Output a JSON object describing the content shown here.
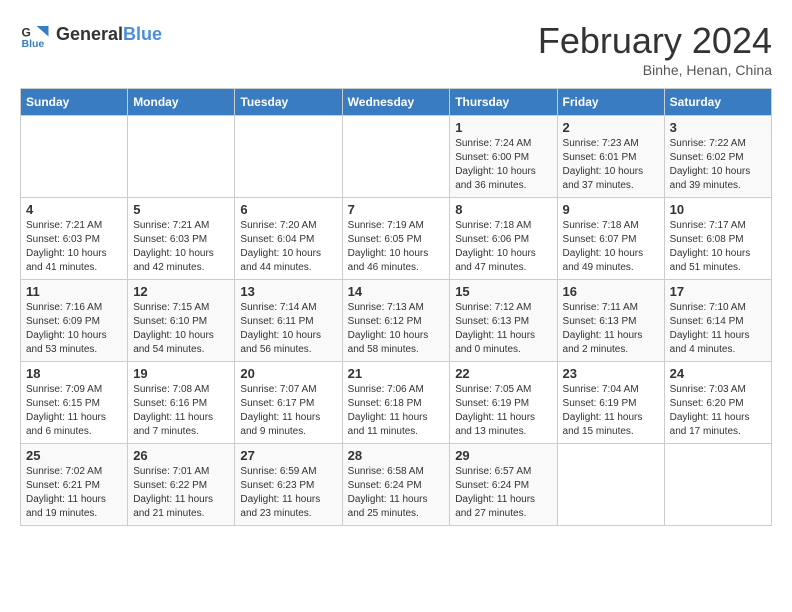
{
  "app": {
    "name": "GeneralBlue",
    "title": "February 2024",
    "subtitle": "Binhe, Henan, China"
  },
  "days_of_week": [
    "Sunday",
    "Monday",
    "Tuesday",
    "Wednesday",
    "Thursday",
    "Friday",
    "Saturday"
  ],
  "weeks": [
    [
      {
        "day": "",
        "info": ""
      },
      {
        "day": "",
        "info": ""
      },
      {
        "day": "",
        "info": ""
      },
      {
        "day": "",
        "info": ""
      },
      {
        "day": "1",
        "info": "Sunrise: 7:24 AM\nSunset: 6:00 PM\nDaylight: 10 hours\nand 36 minutes."
      },
      {
        "day": "2",
        "info": "Sunrise: 7:23 AM\nSunset: 6:01 PM\nDaylight: 10 hours\nand 37 minutes."
      },
      {
        "day": "3",
        "info": "Sunrise: 7:22 AM\nSunset: 6:02 PM\nDaylight: 10 hours\nand 39 minutes."
      }
    ],
    [
      {
        "day": "4",
        "info": "Sunrise: 7:21 AM\nSunset: 6:03 PM\nDaylight: 10 hours\nand 41 minutes."
      },
      {
        "day": "5",
        "info": "Sunrise: 7:21 AM\nSunset: 6:03 PM\nDaylight: 10 hours\nand 42 minutes."
      },
      {
        "day": "6",
        "info": "Sunrise: 7:20 AM\nSunset: 6:04 PM\nDaylight: 10 hours\nand 44 minutes."
      },
      {
        "day": "7",
        "info": "Sunrise: 7:19 AM\nSunset: 6:05 PM\nDaylight: 10 hours\nand 46 minutes."
      },
      {
        "day": "8",
        "info": "Sunrise: 7:18 AM\nSunset: 6:06 PM\nDaylight: 10 hours\nand 47 minutes."
      },
      {
        "day": "9",
        "info": "Sunrise: 7:18 AM\nSunset: 6:07 PM\nDaylight: 10 hours\nand 49 minutes."
      },
      {
        "day": "10",
        "info": "Sunrise: 7:17 AM\nSunset: 6:08 PM\nDaylight: 10 hours\nand 51 minutes."
      }
    ],
    [
      {
        "day": "11",
        "info": "Sunrise: 7:16 AM\nSunset: 6:09 PM\nDaylight: 10 hours\nand 53 minutes."
      },
      {
        "day": "12",
        "info": "Sunrise: 7:15 AM\nSunset: 6:10 PM\nDaylight: 10 hours\nand 54 minutes."
      },
      {
        "day": "13",
        "info": "Sunrise: 7:14 AM\nSunset: 6:11 PM\nDaylight: 10 hours\nand 56 minutes."
      },
      {
        "day": "14",
        "info": "Sunrise: 7:13 AM\nSunset: 6:12 PM\nDaylight: 10 hours\nand 58 minutes."
      },
      {
        "day": "15",
        "info": "Sunrise: 7:12 AM\nSunset: 6:13 PM\nDaylight: 11 hours\nand 0 minutes."
      },
      {
        "day": "16",
        "info": "Sunrise: 7:11 AM\nSunset: 6:13 PM\nDaylight: 11 hours\nand 2 minutes."
      },
      {
        "day": "17",
        "info": "Sunrise: 7:10 AM\nSunset: 6:14 PM\nDaylight: 11 hours\nand 4 minutes."
      }
    ],
    [
      {
        "day": "18",
        "info": "Sunrise: 7:09 AM\nSunset: 6:15 PM\nDaylight: 11 hours\nand 6 minutes."
      },
      {
        "day": "19",
        "info": "Sunrise: 7:08 AM\nSunset: 6:16 PM\nDaylight: 11 hours\nand 7 minutes."
      },
      {
        "day": "20",
        "info": "Sunrise: 7:07 AM\nSunset: 6:17 PM\nDaylight: 11 hours\nand 9 minutes."
      },
      {
        "day": "21",
        "info": "Sunrise: 7:06 AM\nSunset: 6:18 PM\nDaylight: 11 hours\nand 11 minutes."
      },
      {
        "day": "22",
        "info": "Sunrise: 7:05 AM\nSunset: 6:19 PM\nDaylight: 11 hours\nand 13 minutes."
      },
      {
        "day": "23",
        "info": "Sunrise: 7:04 AM\nSunset: 6:19 PM\nDaylight: 11 hours\nand 15 minutes."
      },
      {
        "day": "24",
        "info": "Sunrise: 7:03 AM\nSunset: 6:20 PM\nDaylight: 11 hours\nand 17 minutes."
      }
    ],
    [
      {
        "day": "25",
        "info": "Sunrise: 7:02 AM\nSunset: 6:21 PM\nDaylight: 11 hours\nand 19 minutes."
      },
      {
        "day": "26",
        "info": "Sunrise: 7:01 AM\nSunset: 6:22 PM\nDaylight: 11 hours\nand 21 minutes."
      },
      {
        "day": "27",
        "info": "Sunrise: 6:59 AM\nSunset: 6:23 PM\nDaylight: 11 hours\nand 23 minutes."
      },
      {
        "day": "28",
        "info": "Sunrise: 6:58 AM\nSunset: 6:24 PM\nDaylight: 11 hours\nand 25 minutes."
      },
      {
        "day": "29",
        "info": "Sunrise: 6:57 AM\nSunset: 6:24 PM\nDaylight: 11 hours\nand 27 minutes."
      },
      {
        "day": "",
        "info": ""
      },
      {
        "day": "",
        "info": ""
      }
    ]
  ]
}
